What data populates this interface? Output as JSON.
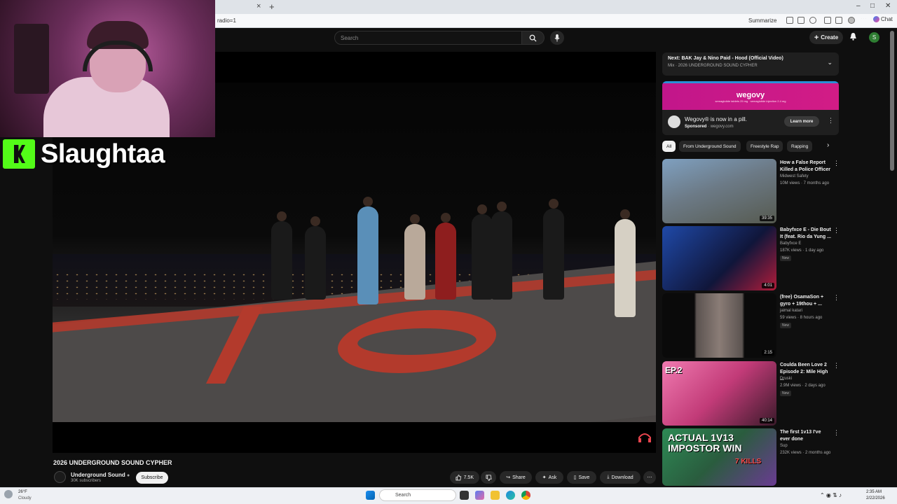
{
  "browser": {
    "tab_close": "×",
    "new_tab": "+",
    "url": "radio=1",
    "summarize_label": "Summarize",
    "chat_label": "Chat",
    "win_min": "–",
    "win_max": "□",
    "win_close": "✕"
  },
  "youtube": {
    "search_placeholder": "Search",
    "create_label": "Create",
    "avatar_letter": "S"
  },
  "overlay": {
    "streamer_name": "Slaughtaa"
  },
  "video": {
    "title": "2026 UNDERGROUND SOUND CYPHER",
    "channel": "Underground Sound",
    "subscribers": "30K subscribers",
    "subscribe_label": "Subscribe",
    "likes": "7.5K",
    "share_label": "Share",
    "ask_label": "Ask",
    "save_label": "Save",
    "download_label": "Download"
  },
  "up_next": {
    "title": "Next: BAK Jay & Nino Paid - Hood (Official Video)",
    "subtitle": "Mix · 2026 UNDERGROUND SOUND CYPHER"
  },
  "ad": {
    "brand": "wegovy",
    "fine_print": "semaglutide tablets 25 mg · semaglutide injection 2.4 mg",
    "title": "Wegovy® is now in a pill.",
    "sponsored": "Sponsored",
    "domain": "wegovy.com",
    "learn_more": "Learn more"
  },
  "chips": [
    "All",
    "From Underground Sound",
    "Freestyle Rap",
    "Rapping"
  ],
  "recommendations": [
    {
      "title": "How a False Report Killed a Police Officer",
      "channel": "Midwest Safety",
      "meta": "10M views · 7 months ago",
      "duration": "39:35",
      "badge": "",
      "colors": [
        "#6f8aa3",
        "#4d5a4a"
      ]
    },
    {
      "title": "Babyfxce E - Die Bout It (feat. Rio da Yung ...",
      "channel": "Babyfxce E",
      "meta": "187K views · 1 day ago",
      "duration": "4:01",
      "badge": "New",
      "colors": [
        "#1d3e8c",
        "#0d0f2a"
      ]
    },
    {
      "title": "(free) OsamaSon + gyro + 19thou + ...",
      "channel": "jaimal katari",
      "meta": "59 views · 8 hours ago",
      "duration": "2:15",
      "badge": "New",
      "colors": [
        "#0d0d0d",
        "#3a3a3a"
      ]
    },
    {
      "title": "Coulda Been Love 2 Episode 2: Mile High ...",
      "channel": "Druski",
      "meta": "2.9M views · 2 days ago",
      "duration": "40:14",
      "badge": "New",
      "colors": [
        "#e95f9a",
        "#8b2f5a"
      ]
    },
    {
      "title": "The first 1v13 I've ever done",
      "channel": "Sup",
      "meta": "232K views · 2 months ago",
      "duration": "",
      "badge": "",
      "colors": [
        "#2e7d4f",
        "#6a3b92"
      ]
    }
  ],
  "rec_thumb_text": {
    "ep": "EP.2",
    "impostor": "ACTUAL 1V13 IMPOSTOR WIN",
    "kills": "7 KILLS"
  },
  "taskbar": {
    "temp": "26°F",
    "weather": "Cloudy",
    "search": "Search",
    "time": "2:35 AM",
    "date": "2/22/2026"
  }
}
